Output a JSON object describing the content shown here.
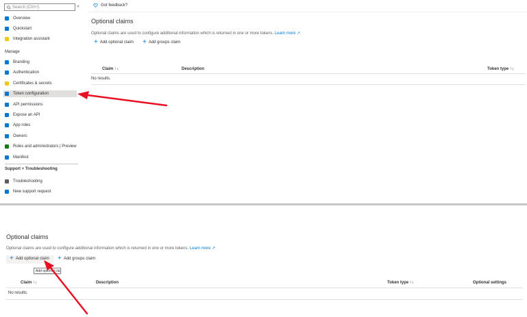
{
  "sidebar": {
    "search_placeholder": "Search (Ctrl+/)",
    "collapse_glyph": "«",
    "items_top": [
      {
        "label": "Overview",
        "color": "#0078d4"
      },
      {
        "label": "Quickstart",
        "color": "#0078d4"
      },
      {
        "label": "Integration assistant",
        "color": "#f2c811"
      }
    ],
    "manage_title": "Manage",
    "manage_items": [
      {
        "label": "Branding",
        "color": "#0078d4"
      },
      {
        "label": "Authentication",
        "color": "#0078d4"
      },
      {
        "label": "Certificates & secrets",
        "color": "#f2c811"
      },
      {
        "label": "Token configuration",
        "color": "#0078d4"
      },
      {
        "label": "API permissions",
        "color": "#0078d4"
      },
      {
        "label": "Expose an API",
        "color": "#0078d4"
      },
      {
        "label": "App roles",
        "color": "#0078d4"
      },
      {
        "label": "Owners",
        "color": "#0078d4"
      },
      {
        "label": "Roles and administrators | Preview",
        "color": "#107c10"
      },
      {
        "label": "Manifest",
        "color": "#0078d4"
      }
    ],
    "support_title": "Support + Troubleshooting",
    "support_items": [
      {
        "label": "Troubleshooting",
        "color": "#605e5c"
      },
      {
        "label": "New support request",
        "color": "#0078d4"
      }
    ]
  },
  "content": {
    "feedback_label": "Got feedback?",
    "title": "Optional claims",
    "description": "Optional claims are used to configure additional information which is returned in one or more tokens.",
    "learn_more": "Learn more",
    "add_optional_claim": "Add optional claim",
    "add_groups_claim": "Add groups claim",
    "col_claim": "Claim ↑↓",
    "col_description": "Description",
    "col_token_type": "Token type ↑↓",
    "no_results": "No results."
  },
  "bottom": {
    "title": "Optional claims",
    "description": "Optional claims are used to configure additional information which is returned in one or more tokens.",
    "learn_more": "Learn more",
    "add_optional_claim": "Add optional claim",
    "add_groups_claim": "Add groups claim",
    "tooltip": "Add optional claim",
    "col_claim": "Claim ↑↓",
    "col_description": "Description",
    "col_token_type": "Token type ↑↓",
    "col_optional_settings": "Optional settings",
    "no_results": "No results."
  },
  "colors": {
    "accent": "#0078d4",
    "annotation_arrow": "#e81123"
  }
}
